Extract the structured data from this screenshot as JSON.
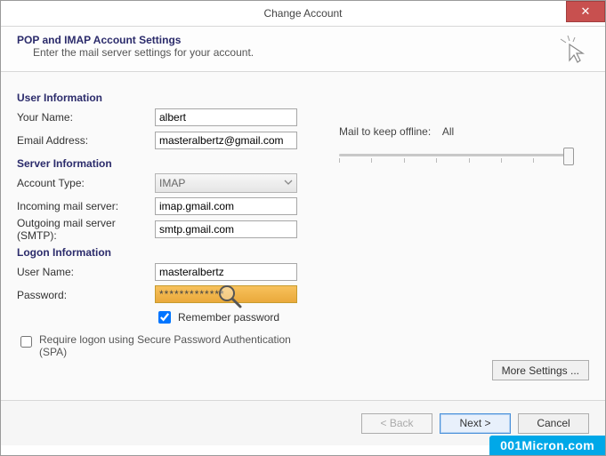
{
  "window": {
    "title": "Change Account"
  },
  "header": {
    "heading": "POP and IMAP Account Settings",
    "sub": "Enter the mail server settings for your account."
  },
  "sections": {
    "user_info": "User Information",
    "server_info": "Server Information",
    "logon_info": "Logon Information"
  },
  "labels": {
    "your_name": "Your Name:",
    "email": "Email Address:",
    "account_type": "Account Type:",
    "incoming": "Incoming mail server:",
    "outgoing": "Outgoing mail server (SMTP):",
    "user_name": "User Name:",
    "password": "Password:"
  },
  "values": {
    "your_name": "albert",
    "email": "masteralbertz@gmail.com",
    "account_type": "IMAP",
    "incoming": "imap.gmail.com",
    "outgoing": "smtp.gmail.com",
    "user_name": "masteralbertz",
    "password_mask": "*************"
  },
  "checkboxes": {
    "remember": "Remember password",
    "spa": "Require logon using Secure Password Authentication (SPA)"
  },
  "right": {
    "mail_keep_label": "Mail to keep offline:",
    "mail_keep_value": "All"
  },
  "buttons": {
    "more_settings": "More Settings ...",
    "back": "< Back",
    "next": "Next >",
    "cancel": "Cancel"
  },
  "watermark": "001Micron.com"
}
